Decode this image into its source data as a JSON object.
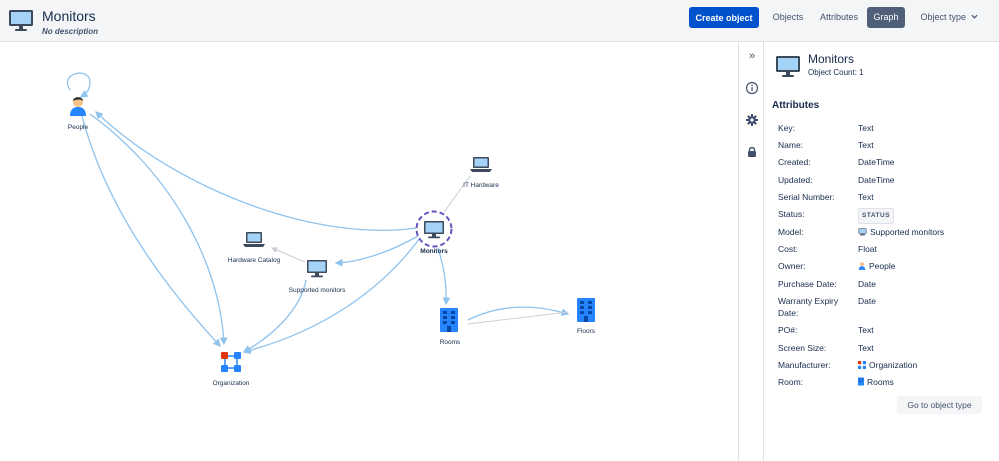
{
  "header": {
    "title": "Monitors",
    "description": "No description",
    "create_button": "Create object",
    "tabs": [
      {
        "label": "Objects",
        "active": false
      },
      {
        "label": "Attributes",
        "active": false
      },
      {
        "label": "Graph",
        "active": true
      },
      {
        "label": "Object type",
        "active": false
      }
    ],
    "dropdown_icon": "chevron-down-icon"
  },
  "graph": {
    "nodes": [
      {
        "id": "people",
        "label": "People",
        "icon": "person-icon"
      },
      {
        "id": "it-hardware",
        "label": "IT Hardware",
        "icon": "laptop-icon"
      },
      {
        "id": "monitors",
        "label": "Monitors",
        "icon": "monitor-icon",
        "selected": true
      },
      {
        "id": "hardware-catalog",
        "label": "Hardware Catalog",
        "icon": "laptop-icon"
      },
      {
        "id": "supported-monitors",
        "label": "Supported monitors",
        "icon": "monitor-icon"
      },
      {
        "id": "rooms",
        "label": "Rooms",
        "icon": "building-icon"
      },
      {
        "id": "floors",
        "label": "Floors",
        "icon": "building-icon"
      },
      {
        "id": "organization",
        "label": "Organization",
        "icon": "organization-icon"
      }
    ],
    "colors": {
      "edge": "#8ec3ee",
      "edge_faint": "#c8cdd4",
      "selection": "#6554c0"
    }
  },
  "sidebar_strip": {
    "icons": [
      "double-chevron-right-icon",
      "info-icon",
      "gear-icon",
      "lock-icon"
    ]
  },
  "panel": {
    "title": "Monitors",
    "object_count_label": "Object Count: 1",
    "attributes_heading": "Attributes",
    "attributes": [
      {
        "key": "Key:",
        "value": "Text"
      },
      {
        "key": "Name:",
        "value": "Text"
      },
      {
        "key": "Created:",
        "value": "DateTime"
      },
      {
        "key": "Updated:",
        "value": "DateTime"
      },
      {
        "key": "Serial Number:",
        "value": "Text"
      },
      {
        "key": "Status:",
        "value": "STATUS"
      },
      {
        "key": "Model:",
        "value": "Supported monitors"
      },
      {
        "key": "Cost:",
        "value": "Float"
      },
      {
        "key": "Owner:",
        "value": "People"
      },
      {
        "key": "Purchase Date:",
        "value": "Date"
      },
      {
        "key": "Warranty Expiry Date:",
        "value": "Date"
      },
      {
        "key": "PO#:",
        "value": "Text"
      },
      {
        "key": "Screen Size:",
        "value": "Text"
      },
      {
        "key": "Manufacturer:",
        "value": "Organization"
      },
      {
        "key": "Room:",
        "value": "Rooms"
      }
    ],
    "goto_button": "Go to object type"
  },
  "colors": {
    "primary": "#0052cc",
    "tab_active": "#505f79",
    "text": "#172b4d"
  }
}
